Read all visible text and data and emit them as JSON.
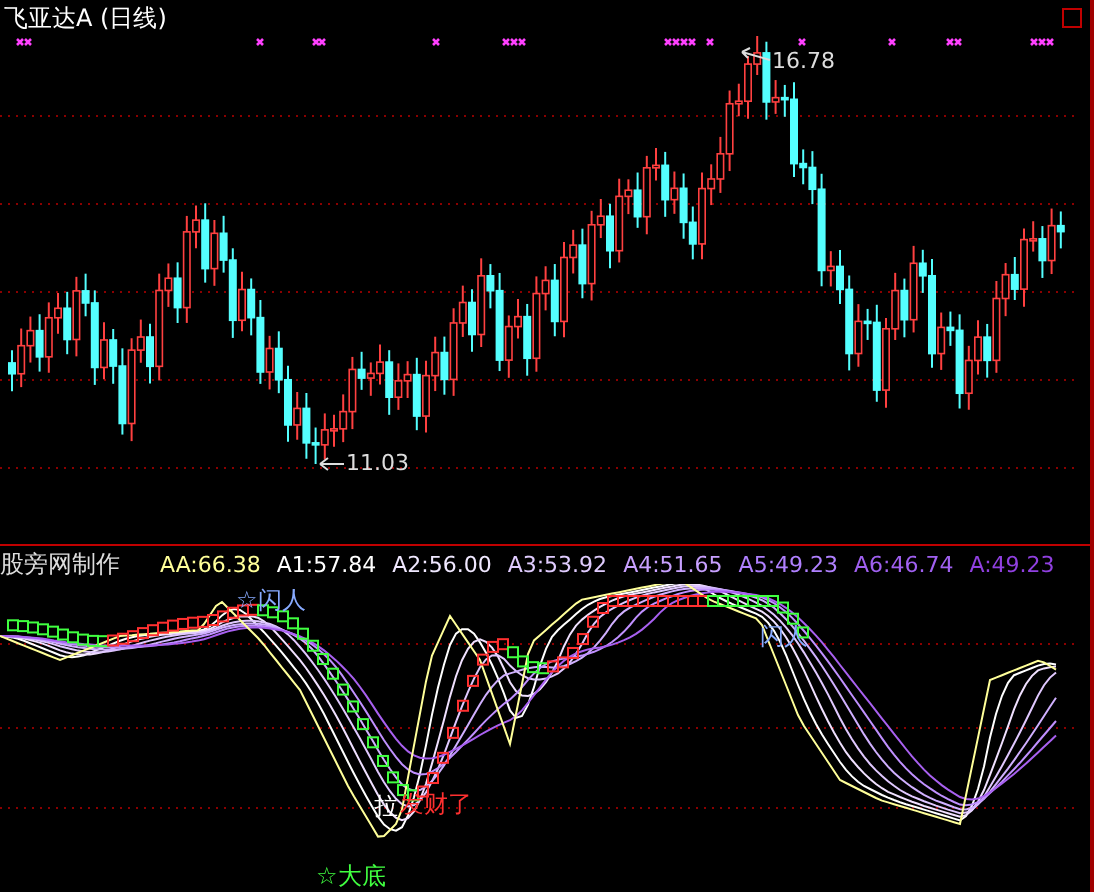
{
  "chart_title": "飞亚达A (日线)",
  "price_high": "16.78",
  "price_low": "11.03",
  "indicator": {
    "name": "股旁网制作",
    "values": [
      {
        "text": "AA:66.38",
        "color": "#ffff99"
      },
      {
        "text": "A1:57.84",
        "color": "#ffffff"
      },
      {
        "text": "A2:56.00",
        "color": "#f0e8ff"
      },
      {
        "text": "A3:53.92",
        "color": "#e0ccff"
      },
      {
        "text": "A4:51.65",
        "color": "#c8a0ff"
      },
      {
        "text": "A5:49.23",
        "color": "#b080ff"
      },
      {
        "text": "A6:46.74",
        "color": "#a060f0"
      },
      {
        "text": "A:49.23",
        "color": "#9040e0"
      }
    ]
  },
  "signals": [
    {
      "text": "☆闪人",
      "color": "#88aaff"
    },
    {
      "text": "闪人",
      "color": "#88aaff"
    },
    {
      "text": "拉",
      "color": "#ffffff"
    },
    {
      "text": "发财了",
      "color": "#ff3030"
    },
    {
      "text": "☆大底",
      "color": "#40ff40"
    }
  ]
}
